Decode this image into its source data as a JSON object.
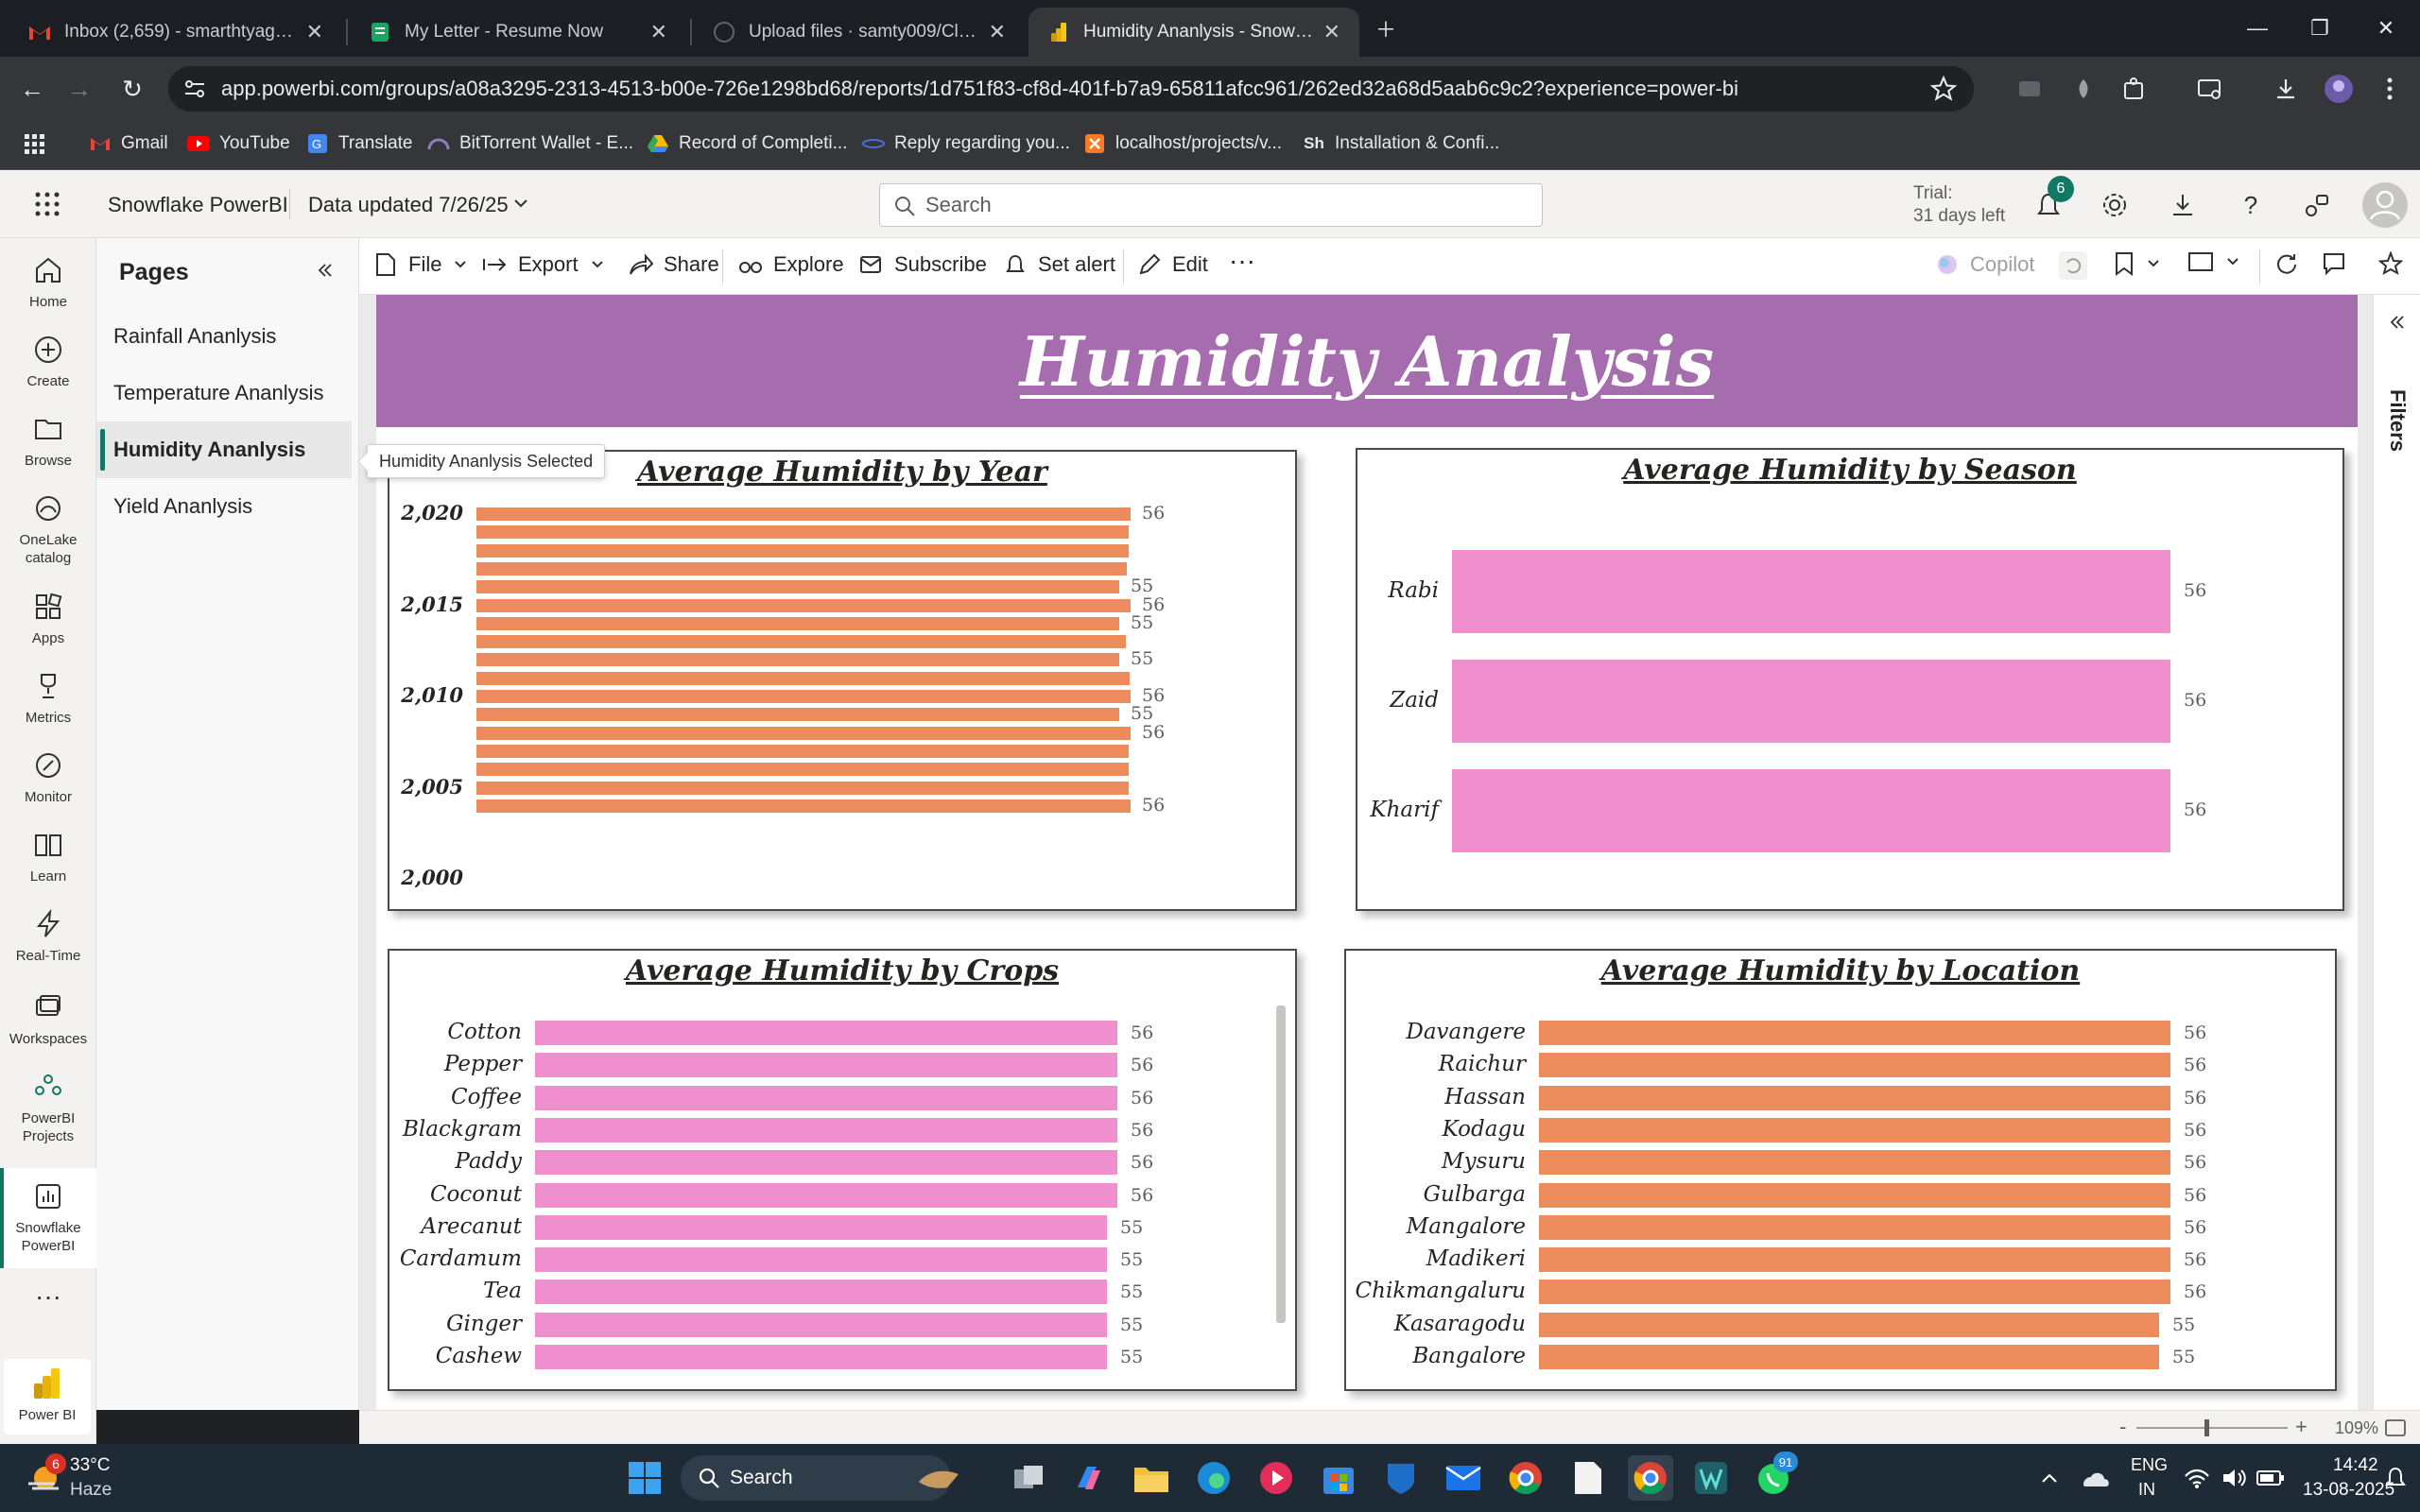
{
  "browser": {
    "tabs": [
      {
        "title": "Inbox (2,659) - smarthtyagi441@",
        "icon": "gmail-icon"
      },
      {
        "title": "My Letter - Resume Now",
        "icon": "resume-icon"
      },
      {
        "title": "Upload files · samty009/Cloud-I",
        "icon": "github-icon"
      },
      {
        "title": "Humidity Ananlysis - Snowflake",
        "icon": "powerbi-icon"
      }
    ],
    "url": "app.powerbi.com/groups/a08a3295-2313-4513-b00e-726e1298bd68/reports/1d751f83-cf8d-401f-b7a9-65811afcc961/262ed32a68d5aab6c9c2?experience=power-bi",
    "bookmarks": [
      "Gmail",
      "YouTube",
      "Translate",
      "BitTorrent Wallet - E...",
      "Record of Completi...",
      "Reply regarding you...",
      "localhost/projects/v...",
      "Installation & Confi..."
    ]
  },
  "pbi": {
    "workspace": "Snowflake PowerBI",
    "data_updated": "Data updated 7/26/25",
    "search_placeholder": "Search",
    "trial_line1": "Trial:",
    "trial_line2": "31 days left",
    "notif_count": "6",
    "rail": [
      {
        "label": "Home",
        "icon": "home-icon"
      },
      {
        "label": "Create",
        "icon": "create-icon"
      },
      {
        "label": "Browse",
        "icon": "browse-icon"
      },
      {
        "label": "OneLake catalog",
        "icon": "onelake-icon"
      },
      {
        "label": "Apps",
        "icon": "apps-icon"
      },
      {
        "label": "Metrics",
        "icon": "metrics-icon"
      },
      {
        "label": "Monitor",
        "icon": "monitor-icon"
      },
      {
        "label": "Learn",
        "icon": "learn-icon"
      },
      {
        "label": "Real-Time",
        "icon": "realtime-icon"
      },
      {
        "label": "Workspaces",
        "icon": "workspaces-icon"
      },
      {
        "label": "PowerBI Projects",
        "icon": "projects-icon"
      },
      {
        "label": "Snowflake PowerBI",
        "icon": "report-icon"
      },
      {
        "label": "Power BI",
        "icon": "powerbi-logo-icon"
      }
    ],
    "pages_title": "Pages",
    "pages": [
      "Rainfall Ananlysis",
      "Temperature Ananlysis",
      "Humidity Ananlysis",
      "Yield Ananlysis"
    ],
    "tooltip": "Humidity Ananlysis Selected",
    "actions": {
      "file": "File",
      "export": "Export",
      "share": "Share",
      "explore": "Explore",
      "subscribe": "Subscribe",
      "set_alert": "Set alert",
      "edit": "Edit",
      "copilot": "Copilot"
    },
    "filters_label": "Filters",
    "zoom": "109%"
  },
  "report_title": "Humidity Analysis",
  "chart_data": [
    {
      "type": "bar",
      "title": "Average Humidity by Year",
      "orientation": "horizontal",
      "y_ticks": [
        "2,020",
        "2,015",
        "2,010",
        "2,005",
        "2,000"
      ],
      "y_range": [
        2000,
        2020
      ],
      "bar_count": 17,
      "years": [
        2020,
        2019,
        2018,
        2017,
        2016,
        2015,
        2014,
        2013,
        2012,
        2011,
        2010,
        2009,
        2008,
        2007,
        2006,
        2005,
        2004
      ],
      "values": [
        56,
        55.8,
        55.8,
        55.7,
        55,
        56,
        55,
        55.6,
        55,
        55.9,
        56,
        55,
        56,
        55.8,
        55.8,
        55.8,
        56
      ],
      "labels": [
        "56",
        "",
        "",
        "",
        "55",
        "56",
        "55",
        "",
        "55",
        "",
        "56",
        "55",
        "56",
        "",
        "",
        "",
        "56"
      ],
      "color": "#ec8c5c"
    },
    {
      "type": "bar",
      "title": "Average Humidity by Season",
      "orientation": "horizontal",
      "categories": [
        "Rabi",
        "Zaid",
        "Kharif"
      ],
      "values": [
        56,
        56,
        56
      ],
      "color": "#ef8fcd"
    },
    {
      "type": "bar",
      "title": "Average Humidity by Crops",
      "orientation": "horizontal",
      "categories": [
        "Cotton",
        "Pepper",
        "Coffee",
        "Blackgram",
        "Paddy",
        "Coconut",
        "Arecanut",
        "Cardamum",
        "Tea",
        "Ginger",
        "Cashew"
      ],
      "values": [
        56,
        56,
        56,
        56,
        56,
        56,
        55,
        55,
        55,
        55,
        55
      ],
      "color": "#ef8fcd"
    },
    {
      "type": "bar",
      "title": "Average Humidity by Location",
      "orientation": "horizontal",
      "categories": [
        "Davangere",
        "Raichur",
        "Hassan",
        "Kodagu",
        "Mysuru",
        "Gulbarga",
        "Mangalore",
        "Madikeri",
        "Chikmangaluru",
        "Kasaragodu",
        "Bangalore"
      ],
      "values": [
        56,
        56,
        56,
        56,
        56,
        56,
        56,
        56,
        56,
        55,
        55
      ],
      "color": "#ec8c5c"
    }
  ],
  "taskbar": {
    "weather_temp": "33°C",
    "weather_desc": "Haze",
    "weather_badge": "6",
    "search": "Search",
    "lang1": "ENG",
    "lang2": "IN",
    "time": "14:42",
    "date": "13-08-2025",
    "whatsapp_badge": "91"
  }
}
